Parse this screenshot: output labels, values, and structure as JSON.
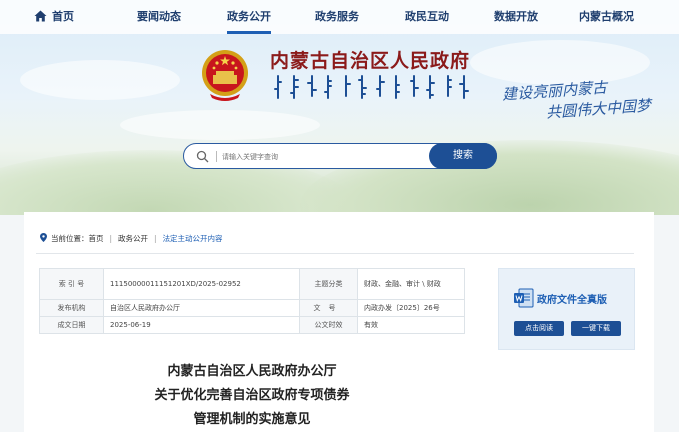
{
  "nav": {
    "items": [
      {
        "label": "首页"
      },
      {
        "label": "要闻动态"
      },
      {
        "label": "政务公开"
      },
      {
        "label": "政务服务"
      },
      {
        "label": "政民互动"
      },
      {
        "label": "数据开放"
      },
      {
        "label": "内蒙古概况"
      }
    ],
    "active_index": 2
  },
  "header": {
    "site_title": "内蒙古自治区人民政府",
    "slogan_line1": "建设亮丽内蒙古",
    "slogan_line2": "共圆伟大中国梦"
  },
  "search": {
    "placeholder": "请输入关键字查询",
    "button_label": "搜索"
  },
  "breadcrumb": {
    "prefix": "当前位置：",
    "items": [
      "首页",
      "政务公开",
      "法定主动公开内容"
    ]
  },
  "meta_table": {
    "index_label": "索 引 号",
    "index_value": "11150000011151201XD/2025-02952",
    "topic_label": "主题分类",
    "topic_value": "财政、金融、审计 \\ 财政",
    "org_label": "发布机构",
    "org_value": "自治区人民政府办公厅",
    "docno_label": "文号",
    "docno_value": "内政办发〔2025〕26号",
    "date_label": "成文日期",
    "date_value": "2025-06-19",
    "validity_label": "公文时效",
    "validity_value": "有效"
  },
  "side_panel": {
    "title": "政府文件全真版",
    "read_button": "点击阅读",
    "download_button": "一键下载"
  },
  "document": {
    "title_line1": "内蒙古自治区人民政府办公厅",
    "title_line2": "关于优化完善自治区政府专项债券",
    "title_line3": "管理机制的实施意见"
  },
  "colors": {
    "primary": "#1d4f95",
    "title_red": "#8b1a1a",
    "link_blue": "#1e5fb4"
  }
}
